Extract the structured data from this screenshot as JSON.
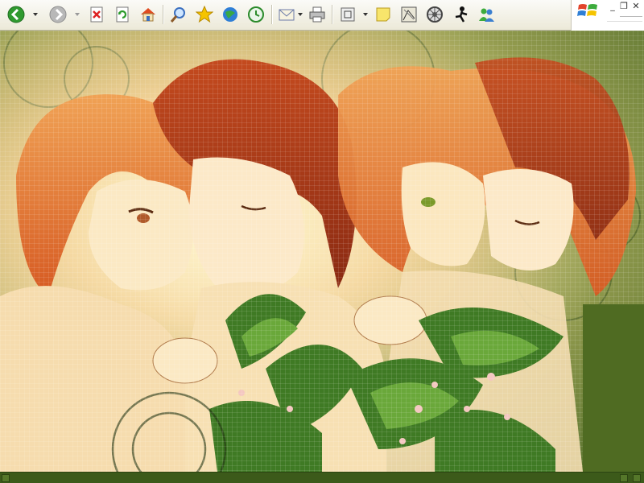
{
  "toolbar": {
    "icons": [
      "back-icon",
      "forward-icon",
      "stop-icon",
      "refresh-icon",
      "home-icon",
      "search-icon",
      "favorites-icon",
      "media-icon",
      "history-icon",
      "mail-icon",
      "print-icon",
      "fullscreen-icon",
      "note-icon",
      "sketch-icon",
      "dial-icon",
      "aim-icon",
      "messenger-icon"
    ]
  },
  "window": {
    "minimize_label": "_",
    "restore_label": "❐",
    "close_label": "✕"
  },
  "colors": {
    "toolbar_bg": "#ece9d8",
    "content_green": "#4d6b28",
    "hair_orange": "#d9632a",
    "skin": "#fbe9c4"
  },
  "image": {
    "subject": "anime-wallpaper"
  }
}
